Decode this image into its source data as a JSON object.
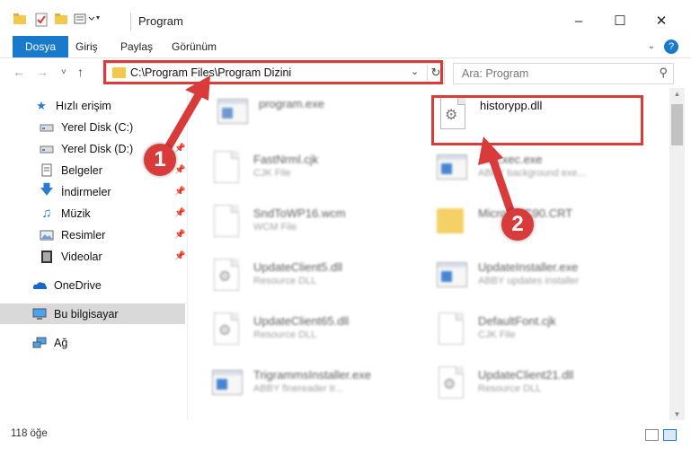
{
  "window": {
    "title": "Program",
    "minimize": "–",
    "maximize": "☐",
    "close": "✕"
  },
  "ribbon": {
    "tabs": [
      "Dosya",
      "Giriş",
      "Paylaş",
      "Görünüm"
    ],
    "help": "?"
  },
  "nav": {
    "back": "←",
    "forward": "→",
    "recent": "˅",
    "up": "↑",
    "address": "C:\\Program Files\\Program Dizini",
    "search_placeholder": "Ara: Program"
  },
  "sidebar": {
    "items": [
      {
        "label": "Hızlı erişim",
        "icon": "star-icon"
      },
      {
        "label": "Yerel Disk (C:)",
        "icon": "drive-icon"
      },
      {
        "label": "Yerel Disk (D:)",
        "icon": "drive-icon"
      },
      {
        "label": "Belgeler",
        "icon": "documents-icon"
      },
      {
        "label": "İndirmeler",
        "icon": "download-icon"
      },
      {
        "label": "Müzik",
        "icon": "music-icon"
      },
      {
        "label": "Resimler",
        "icon": "pictures-icon"
      },
      {
        "label": "Videolar",
        "icon": "video-icon"
      },
      {
        "label": "OneDrive",
        "icon": "cloud-icon"
      },
      {
        "label": "Bu bilgisayar",
        "icon": "computer-icon"
      },
      {
        "label": "Ağ",
        "icon": "network-icon"
      }
    ]
  },
  "files": [
    {
      "name": "program.exe",
      "sub": ""
    },
    {
      "name": "historypp.dll",
      "sub": ""
    },
    {
      "name": "FastNrml.cjk",
      "sub": "CJK File"
    },
    {
      "name": "...bExec.exe",
      "sub": "ABBY background exe..."
    },
    {
      "name": "SndToWP16.wcm",
      "sub": "WCM File"
    },
    {
      "name": "Micro...VC90.CRT",
      "sub": ""
    },
    {
      "name": "UpdateClient5.dll",
      "sub": "Resource DLL"
    },
    {
      "name": "UpdateInstaller.exe",
      "sub": "ABBY updates installer"
    },
    {
      "name": "UpdateClient65.dll",
      "sub": "Resource DLL"
    },
    {
      "name": "DefaultFont.cjk",
      "sub": "CJK File"
    },
    {
      "name": "TrigrammsInstaller.exe",
      "sub": "ABBY finereader tr..."
    },
    {
      "name": "UpdateClient21.dll",
      "sub": "Resource DLL"
    }
  ],
  "annotations": {
    "step1": "1",
    "step2": "2"
  },
  "status": {
    "count": "118 öğe"
  }
}
